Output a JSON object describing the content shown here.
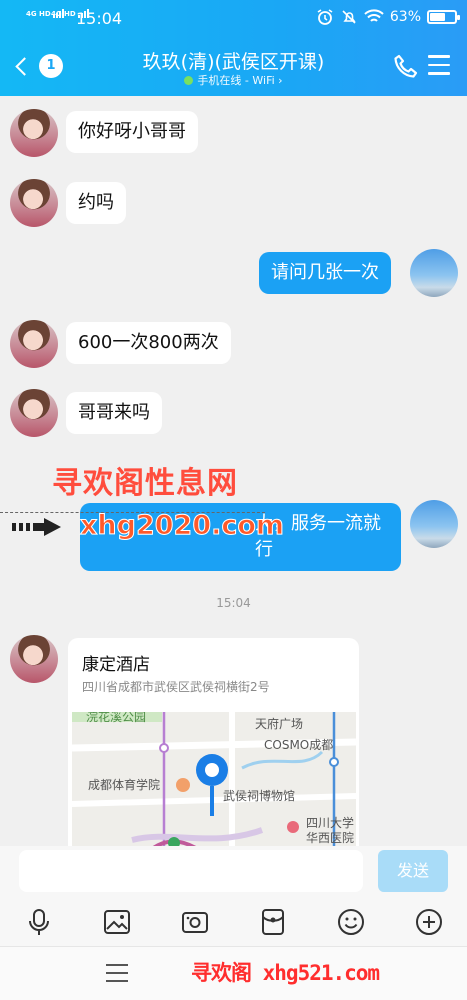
{
  "status_bar": {
    "signal1": "4G HD",
    "signal2": "4G HD",
    "time": "15:04",
    "battery": "63%",
    "battery_level": 0.63
  },
  "header": {
    "unread": "1",
    "title": "玖玖(清)(武侯区开课)",
    "subtitle": "手机在线 - WiFi ›"
  },
  "messages": [
    {
      "side": "in",
      "text": "你好呀小哥哥"
    },
    {
      "side": "in",
      "text": "约吗"
    },
    {
      "side": "out",
      "text": "请问几张一次"
    },
    {
      "side": "in",
      "text": "600一次800两次"
    },
    {
      "side": "in",
      "text": "哥哥来吗"
    },
    {
      "side": "out",
      "text": "大，服务一流就行"
    }
  ],
  "timestamp": "15:04",
  "location": {
    "name": "康定酒店",
    "address": "四川省成都市武侯区武侯祠横街2号",
    "map_labels": {
      "park": "浣花溪公园",
      "tianfu": "天府广场",
      "cosmo": "COSMO成都",
      "school": "成都体育学院",
      "museum": "武侯祠博物馆",
      "hospital": "四川大学华西医院"
    }
  },
  "watermarks": {
    "top": "寻欢阁性息网",
    "middle": "xhg2020.com",
    "bottom": "寻欢阁 xhg521.com"
  },
  "composer": {
    "placeholder": "",
    "send_label": "发送"
  },
  "colors": {
    "header_blue": "#1aa7f5",
    "bubble_out": "#1ba1f4",
    "bubble_in": "#ffffff",
    "send_disabled": "#a9dcf8"
  }
}
